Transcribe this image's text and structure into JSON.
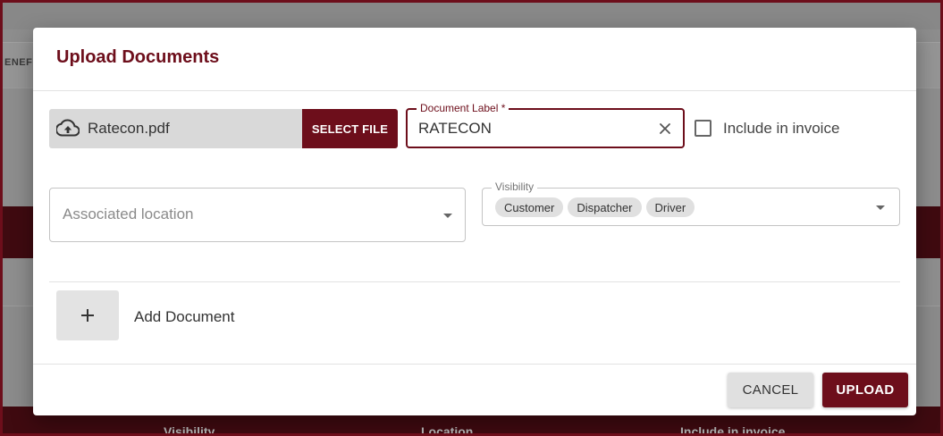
{
  "background": {
    "tab_text": "ENEF",
    "columns": [
      "Visibility",
      "Location",
      "Include in invoice"
    ]
  },
  "dialog": {
    "title": "Upload Documents",
    "file": {
      "name": "Ratecon.pdf",
      "select_label": "SELECT FILE",
      "icon": "cloud-upload-icon"
    },
    "document_label": {
      "legend": "Document Label *",
      "value": "RATECON"
    },
    "include_in_invoice": {
      "label": "Include in invoice",
      "checked": false
    },
    "associated_location": {
      "placeholder": "Associated location"
    },
    "visibility": {
      "legend": "Visibility",
      "chips": [
        "Customer",
        "Dispatcher",
        "Driver"
      ]
    },
    "add_document_label": "Add Document",
    "cancel_label": "CANCEL",
    "upload_label": "UPLOAD"
  },
  "colors": {
    "accent": "#6d0e1b",
    "chip_bg": "#e0e0e0",
    "file_box_bg": "#d9d9d9"
  }
}
